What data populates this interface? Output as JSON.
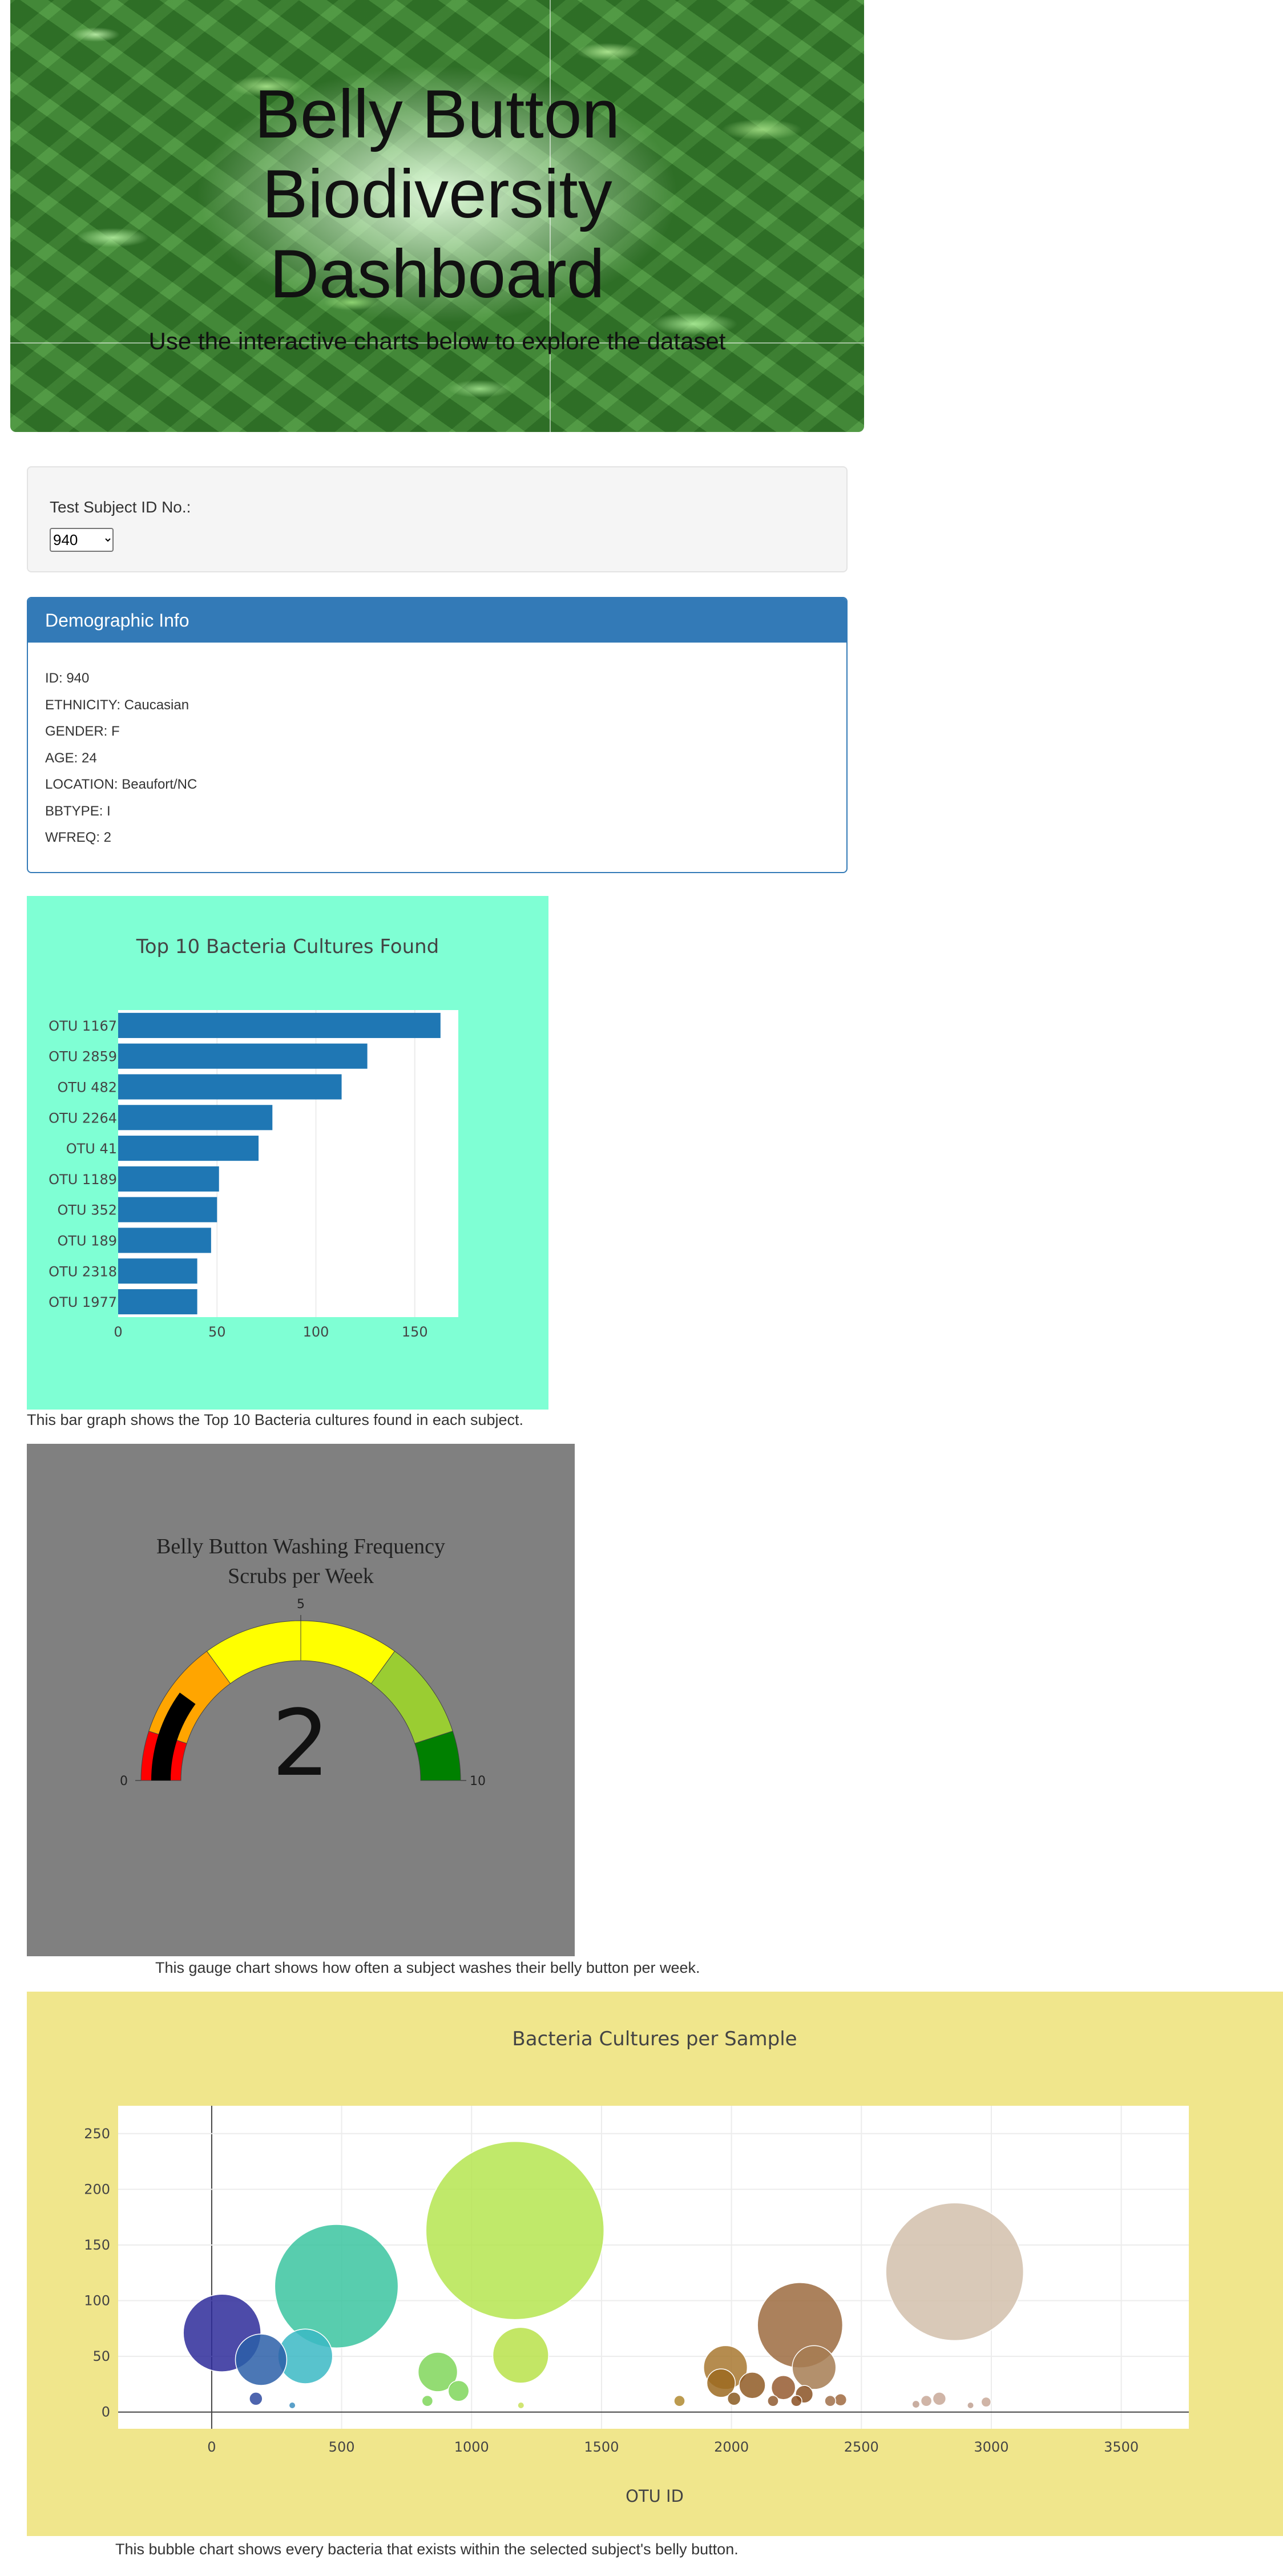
{
  "hero": {
    "title_lines": [
      "Belly Button",
      "Biodiversity",
      "Dashboard"
    ],
    "subtitle": "Use the interactive charts below to explore the dataset"
  },
  "selector": {
    "label": "Test Subject ID No.:",
    "selected": "940"
  },
  "demographic": {
    "heading": "Demographic Info",
    "lines": [
      "ID: 940",
      "ETHNICITY: Caucasian",
      "GENDER: F",
      "AGE: 24",
      "LOCATION: Beaufort/NC",
      "BBTYPE: I",
      "WFREQ: 2"
    ]
  },
  "captions": {
    "bar": "This bar graph shows the Top 10 Bacteria cultures found in each subject.",
    "gauge": "This gauge chart shows how often a subject washes their belly button per week.",
    "bubble": "This bubble chart shows every bacteria that exists within the selected subject's belly button."
  },
  "colors": {
    "bar_bg": "#7fffd4",
    "bar_fill": "#1f77b4",
    "gauge_bg": "#808080",
    "bubble_bg": "#f0e68c",
    "panel_primary": "#337ab7"
  },
  "chart_data": [
    {
      "type": "bar",
      "orientation": "horizontal",
      "title": "Top 10 Bacteria Cultures Found",
      "categories": [
        "OTU 1167",
        "OTU 2859",
        "OTU 482",
        "OTU 2264",
        "OTU 41",
        "OTU 1189",
        "OTU 352",
        "OTU 189",
        "OTU 2318",
        "OTU 1977"
      ],
      "values": [
        163,
        126,
        113,
        78,
        71,
        51,
        50,
        47,
        40,
        40
      ],
      "xlim": [
        0,
        172
      ],
      "xticks": [
        0,
        50,
        100,
        150
      ],
      "grid": true
    },
    {
      "type": "gauge",
      "title": "Belly Button Washing Frequency",
      "subtitle": "Scrubs per Week",
      "value": 2,
      "range": [
        0,
        10
      ],
      "tick_labels": [
        "0",
        "5",
        "10"
      ],
      "bands": [
        {
          "from": 0,
          "to": 1,
          "color": "#ff0000"
        },
        {
          "from": 1,
          "to": 3,
          "color": "#ffa500"
        },
        {
          "from": 3,
          "to": 5,
          "color": "#ffff00"
        },
        {
          "from": 5,
          "to": 7,
          "color": "#ffff00"
        },
        {
          "from": 7,
          "to": 9,
          "color": "#9acd32"
        },
        {
          "from": 9,
          "to": 10,
          "color": "#008000"
        }
      ],
      "bar_color": "#000000"
    },
    {
      "type": "scatter",
      "title": "Bacteria Cultures per Sample",
      "xlabel": "OTU ID",
      "ylabel": "",
      "xlim": [
        -360,
        3760
      ],
      "ylim": [
        -15,
        275
      ],
      "xticks": [
        0,
        500,
        1000,
        1500,
        2000,
        2500,
        3000,
        3500
      ],
      "yticks": [
        0,
        50,
        100,
        150,
        200,
        250
      ],
      "grid": true,
      "points": [
        {
          "x": 40,
          "y": 71,
          "r": 71,
          "color": "#2e2b9a"
        },
        {
          "x": 190,
          "y": 47,
          "r": 47,
          "color": "#2c5fa8"
        },
        {
          "x": 170,
          "y": 12,
          "r": 12,
          "color": "#2f4aa0"
        },
        {
          "x": 480,
          "y": 113,
          "r": 113,
          "color": "#3bc4a0"
        },
        {
          "x": 360,
          "y": 50,
          "r": 50,
          "color": "#3bb8c4"
        },
        {
          "x": 310,
          "y": 6,
          "r": 6,
          "color": "#3d8fc0"
        },
        {
          "x": 1167,
          "y": 163,
          "r": 163,
          "color": "#b5e550"
        },
        {
          "x": 1189,
          "y": 51,
          "r": 51,
          "color": "#b8e24a"
        },
        {
          "x": 870,
          "y": 36,
          "r": 36,
          "color": "#80d65a"
        },
        {
          "x": 950,
          "y": 19,
          "r": 19,
          "color": "#7fd65a"
        },
        {
          "x": 830,
          "y": 10,
          "r": 10,
          "color": "#7fd65a"
        },
        {
          "x": 1190,
          "y": 6,
          "r": 6,
          "color": "#c8e05a"
        },
        {
          "x": 2264,
          "y": 78,
          "r": 78,
          "color": "#9c6b40"
        },
        {
          "x": 2318,
          "y": 40,
          "r": 40,
          "color": "#a67c52"
        },
        {
          "x": 1977,
          "y": 40,
          "r": 40,
          "color": "#a87830"
        },
        {
          "x": 1960,
          "y": 26,
          "r": 26,
          "color": "#9c6a20"
        },
        {
          "x": 2080,
          "y": 24,
          "r": 24,
          "color": "#8f5a25"
        },
        {
          "x": 2200,
          "y": 22,
          "r": 22,
          "color": "#955a30"
        },
        {
          "x": 2280,
          "y": 16,
          "r": 16,
          "color": "#8a5225"
        },
        {
          "x": 2010,
          "y": 12,
          "r": 12,
          "color": "#8a5a20"
        },
        {
          "x": 2160,
          "y": 10,
          "r": 10,
          "color": "#8f5a30"
        },
        {
          "x": 2250,
          "y": 10,
          "r": 10,
          "color": "#8a4f22"
        },
        {
          "x": 2420,
          "y": 11,
          "r": 11,
          "color": "#a06a40"
        },
        {
          "x": 2380,
          "y": 10,
          "r": 10,
          "color": "#a0704a"
        },
        {
          "x": 1800,
          "y": 10,
          "r": 10,
          "color": "#b08a30"
        },
        {
          "x": 2859,
          "y": 126,
          "r": 126,
          "color": "#d2bfac"
        },
        {
          "x": 2800,
          "y": 12,
          "r": 12,
          "color": "#c8a898"
        },
        {
          "x": 2750,
          "y": 10,
          "r": 10,
          "color": "#c8a898"
        },
        {
          "x": 2980,
          "y": 9,
          "r": 9,
          "color": "#c8a898"
        },
        {
          "x": 2710,
          "y": 7,
          "r": 7,
          "color": "#c0a090"
        },
        {
          "x": 2920,
          "y": 6,
          "r": 6,
          "color": "#c0a090"
        }
      ]
    }
  ]
}
